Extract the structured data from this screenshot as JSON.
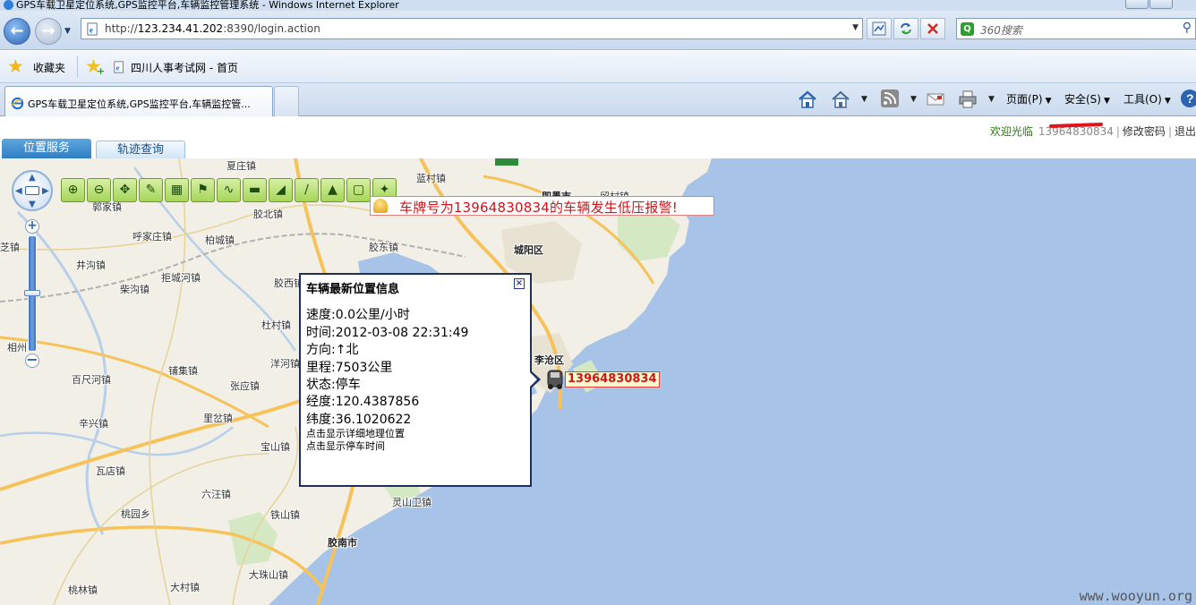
{
  "window": {
    "title": "GPS车载卫星定位系统,GPS监控平台,车辆监控管理系统 - Windows Internet Explorer"
  },
  "address_bar": {
    "url_prefix": "http://",
    "url_host": "123.234.41.202",
    "url_rest": ":8390/login.action"
  },
  "search_box": {
    "placeholder": "360搜索"
  },
  "favorites_bar": {
    "favorites_label": "收藏夹",
    "links": [
      {
        "label": "四川人事考试网 - 首页"
      }
    ]
  },
  "tabs": [
    {
      "label": "GPS车载卫星定位系统,GPS监控平台,车辆监控管..."
    }
  ],
  "command_bar": {
    "page": "页面(P)",
    "safety": "安全(S)",
    "tools": "工具(O)"
  },
  "header": {
    "welcome": "欢迎光临",
    "plate": "13964830834",
    "change_password": "修改密码",
    "logout": "退出"
  },
  "nav_tabs": {
    "position_service": "位置服务",
    "track_query": "轨迹查询"
  },
  "alarm": {
    "message": "车牌号为13964830834的车辆发生低压报警!"
  },
  "info_popup": {
    "title": "车辆最新位置信息",
    "rows": [
      {
        "key": "速度:",
        "value": "0.0公里/小时"
      },
      {
        "key": "时间:",
        "value": "2012-03-08 22:31:49"
      },
      {
        "key": "方向:",
        "value": "↑北"
      },
      {
        "key": "里程:",
        "value": "7503公里"
      },
      {
        "key": "状态:",
        "value": "停车"
      },
      {
        "key": "经度:",
        "value": "120.4387856"
      },
      {
        "key": "纬度:",
        "value": "36.1020622"
      }
    ],
    "links": [
      "点击显示详细地理位置",
      "点击显示停车时间"
    ]
  },
  "vehicle": {
    "label": "13964830834"
  },
  "map": {
    "places": [
      {
        "name": "夏庄镇"
      },
      {
        "name": "蓝村镇"
      },
      {
        "name": "即墨市"
      },
      {
        "name": "留村镇"
      },
      {
        "name": "胶北镇"
      },
      {
        "name": "城阳区"
      },
      {
        "name": "呼家庄镇"
      },
      {
        "name": "柏城镇"
      },
      {
        "name": "胶东镇"
      },
      {
        "name": "井沟镇"
      },
      {
        "name": "拒城河镇"
      },
      {
        "name": "柴沟镇"
      },
      {
        "name": "胶西镇"
      },
      {
        "name": "杜村镇"
      },
      {
        "name": "李沧区"
      },
      {
        "name": "相州"
      },
      {
        "name": "百尺河镇"
      },
      {
        "name": "铺集镇"
      },
      {
        "name": "洋河镇"
      },
      {
        "name": "张应镇"
      },
      {
        "name": "辛兴镇"
      },
      {
        "name": "里岔镇"
      },
      {
        "name": "宝山镇"
      },
      {
        "name": "瓦店镇"
      },
      {
        "name": "六汪镇"
      },
      {
        "name": "桃园乡"
      },
      {
        "name": "铁山镇"
      },
      {
        "name": "灵山卫镇"
      },
      {
        "name": "胶南市"
      },
      {
        "name": "大珠山镇"
      },
      {
        "name": "大村镇"
      },
      {
        "name": "桃林镇"
      },
      {
        "name": "郭家镇"
      },
      {
        "name": "芝镇"
      }
    ]
  },
  "watermark": "www.wooyun.org"
}
